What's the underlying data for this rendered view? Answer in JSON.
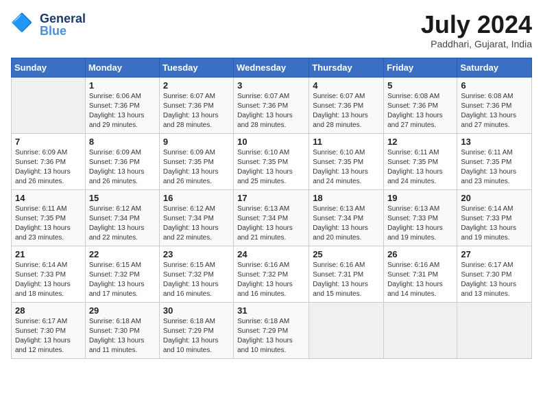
{
  "header": {
    "logo_general": "General",
    "logo_blue": "Blue",
    "month_year": "July 2024",
    "location": "Paddhari, Gujarat, India"
  },
  "calendar": {
    "days": [
      "Sunday",
      "Monday",
      "Tuesday",
      "Wednesday",
      "Thursday",
      "Friday",
      "Saturday"
    ],
    "weeks": [
      [
        {
          "date": "",
          "info": ""
        },
        {
          "date": "1",
          "info": "Sunrise: 6:06 AM\nSunset: 7:36 PM\nDaylight: 13 hours and 29 minutes."
        },
        {
          "date": "2",
          "info": "Sunrise: 6:07 AM\nSunset: 7:36 PM\nDaylight: 13 hours and 28 minutes."
        },
        {
          "date": "3",
          "info": "Sunrise: 6:07 AM\nSunset: 7:36 PM\nDaylight: 13 hours and 28 minutes."
        },
        {
          "date": "4",
          "info": "Sunrise: 6:07 AM\nSunset: 7:36 PM\nDaylight: 13 hours and 28 minutes."
        },
        {
          "date": "5",
          "info": "Sunrise: 6:08 AM\nSunset: 7:36 PM\nDaylight: 13 hours and 27 minutes."
        },
        {
          "date": "6",
          "info": "Sunrise: 6:08 AM\nSunset: 7:36 PM\nDaylight: 13 hours and 27 minutes."
        }
      ],
      [
        {
          "date": "7",
          "info": "Sunrise: 6:09 AM\nSunset: 7:36 PM\nDaylight: 13 hours and 26 minutes."
        },
        {
          "date": "8",
          "info": "Sunrise: 6:09 AM\nSunset: 7:36 PM\nDaylight: 13 hours and 26 minutes."
        },
        {
          "date": "9",
          "info": "Sunrise: 6:09 AM\nSunset: 7:35 PM\nDaylight: 13 hours and 26 minutes."
        },
        {
          "date": "10",
          "info": "Sunrise: 6:10 AM\nSunset: 7:35 PM\nDaylight: 13 hours and 25 minutes."
        },
        {
          "date": "11",
          "info": "Sunrise: 6:10 AM\nSunset: 7:35 PM\nDaylight: 13 hours and 24 minutes."
        },
        {
          "date": "12",
          "info": "Sunrise: 6:11 AM\nSunset: 7:35 PM\nDaylight: 13 hours and 24 minutes."
        },
        {
          "date": "13",
          "info": "Sunrise: 6:11 AM\nSunset: 7:35 PM\nDaylight: 13 hours and 23 minutes."
        }
      ],
      [
        {
          "date": "14",
          "info": "Sunrise: 6:11 AM\nSunset: 7:35 PM\nDaylight: 13 hours and 23 minutes."
        },
        {
          "date": "15",
          "info": "Sunrise: 6:12 AM\nSunset: 7:34 PM\nDaylight: 13 hours and 22 minutes."
        },
        {
          "date": "16",
          "info": "Sunrise: 6:12 AM\nSunset: 7:34 PM\nDaylight: 13 hours and 22 minutes."
        },
        {
          "date": "17",
          "info": "Sunrise: 6:13 AM\nSunset: 7:34 PM\nDaylight: 13 hours and 21 minutes."
        },
        {
          "date": "18",
          "info": "Sunrise: 6:13 AM\nSunset: 7:34 PM\nDaylight: 13 hours and 20 minutes."
        },
        {
          "date": "19",
          "info": "Sunrise: 6:13 AM\nSunset: 7:33 PM\nDaylight: 13 hours and 19 minutes."
        },
        {
          "date": "20",
          "info": "Sunrise: 6:14 AM\nSunset: 7:33 PM\nDaylight: 13 hours and 19 minutes."
        }
      ],
      [
        {
          "date": "21",
          "info": "Sunrise: 6:14 AM\nSunset: 7:33 PM\nDaylight: 13 hours and 18 minutes."
        },
        {
          "date": "22",
          "info": "Sunrise: 6:15 AM\nSunset: 7:32 PM\nDaylight: 13 hours and 17 minutes."
        },
        {
          "date": "23",
          "info": "Sunrise: 6:15 AM\nSunset: 7:32 PM\nDaylight: 13 hours and 16 minutes."
        },
        {
          "date": "24",
          "info": "Sunrise: 6:16 AM\nSunset: 7:32 PM\nDaylight: 13 hours and 16 minutes."
        },
        {
          "date": "25",
          "info": "Sunrise: 6:16 AM\nSunset: 7:31 PM\nDaylight: 13 hours and 15 minutes."
        },
        {
          "date": "26",
          "info": "Sunrise: 6:16 AM\nSunset: 7:31 PM\nDaylight: 13 hours and 14 minutes."
        },
        {
          "date": "27",
          "info": "Sunrise: 6:17 AM\nSunset: 7:30 PM\nDaylight: 13 hours and 13 minutes."
        }
      ],
      [
        {
          "date": "28",
          "info": "Sunrise: 6:17 AM\nSunset: 7:30 PM\nDaylight: 13 hours and 12 minutes."
        },
        {
          "date": "29",
          "info": "Sunrise: 6:18 AM\nSunset: 7:30 PM\nDaylight: 13 hours and 11 minutes."
        },
        {
          "date": "30",
          "info": "Sunrise: 6:18 AM\nSunset: 7:29 PM\nDaylight: 13 hours and 10 minutes."
        },
        {
          "date": "31",
          "info": "Sunrise: 6:18 AM\nSunset: 7:29 PM\nDaylight: 13 hours and 10 minutes."
        },
        {
          "date": "",
          "info": ""
        },
        {
          "date": "",
          "info": ""
        },
        {
          "date": "",
          "info": ""
        }
      ]
    ]
  }
}
